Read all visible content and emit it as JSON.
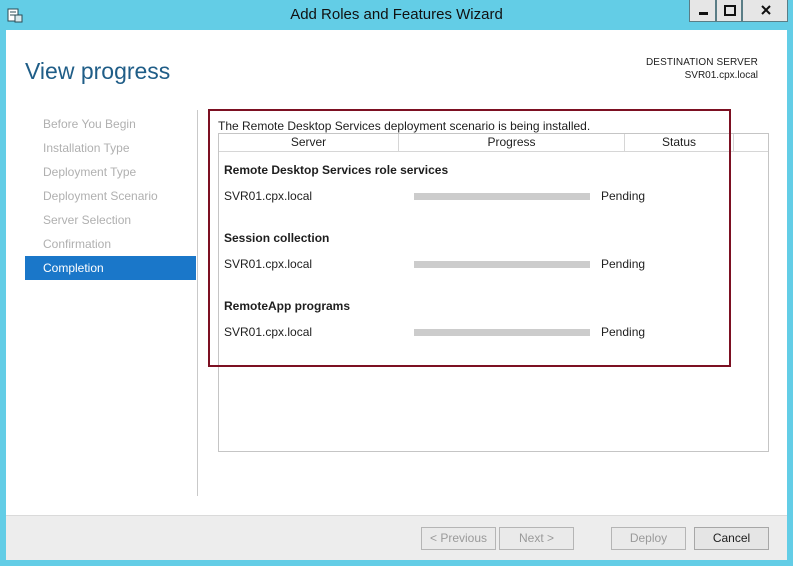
{
  "window": {
    "title": "Add Roles and Features Wizard",
    "accent_color": "#63cde6"
  },
  "header": {
    "page_title": "View progress",
    "destination_label": "DESTINATION SERVER",
    "destination_server": "SVR01.cpx.local"
  },
  "sidebar": {
    "items": [
      {
        "label": "Before You Begin",
        "active": false
      },
      {
        "label": "Installation Type",
        "active": false
      },
      {
        "label": "Deployment Type",
        "active": false
      },
      {
        "label": "Deployment Scenario",
        "active": false
      },
      {
        "label": "Server Selection",
        "active": false
      },
      {
        "label": "Confirmation",
        "active": false
      },
      {
        "label": "Completion",
        "active": true
      }
    ],
    "active_color": "#1a77c9"
  },
  "main": {
    "status_message": "The Remote Desktop Services deployment scenario is being installed.",
    "columns": [
      "Server",
      "Progress",
      "Status"
    ],
    "groups": [
      {
        "title": "Remote Desktop Services role services",
        "rows": [
          {
            "server": "SVR01.cpx.local",
            "progress": 0,
            "status": "Pending"
          }
        ]
      },
      {
        "title": "Session collection",
        "rows": [
          {
            "server": "SVR01.cpx.local",
            "progress": 0,
            "status": "Pending"
          }
        ]
      },
      {
        "title": "RemoteApp programs",
        "rows": [
          {
            "server": "SVR01.cpx.local",
            "progress": 0,
            "status": "Pending"
          }
        ]
      }
    ],
    "highlight_color": "#7c1022"
  },
  "footer": {
    "previous_label": "< Previous",
    "next_label": "Next >",
    "deploy_label": "Deploy",
    "cancel_label": "Cancel"
  }
}
